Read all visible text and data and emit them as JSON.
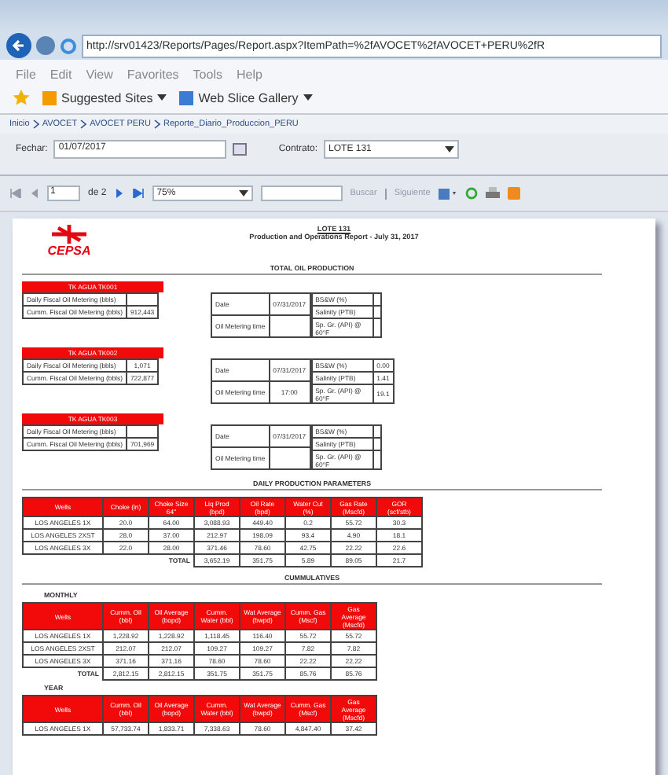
{
  "browser": {
    "url": "http://srv01423/Reports/Pages/Report.aspx?ItemPath=%2fAVOCET%2fAVOCET+PERU%2fR",
    "menu": [
      "File",
      "Edit",
      "View",
      "Favorites",
      "Tools",
      "Help"
    ],
    "favorites": [
      "Suggested Sites",
      "Web Slice Gallery"
    ]
  },
  "breadcrumb": [
    "Inicio",
    "AVOCET",
    "AVOCET PERU",
    "Reporte_Diario_Produccion_PERU"
  ],
  "params": [
    {
      "label": "Fechar:",
      "value": "01/07/2017",
      "kind": "date"
    },
    {
      "label": "Contrato:",
      "value": "LOTE 131",
      "kind": "select"
    }
  ],
  "toolbar": {
    "page": "1",
    "of": "de 2",
    "zoom": "75%",
    "find": "Buscar",
    "next": "Siguiente"
  },
  "report": {
    "logo": "CEPSA",
    "title": "LOTE 131",
    "subtitle": "Production and Operations Report - July 31, 2017",
    "section": "TOTAL OIL PRODUCTION",
    "tanks": [
      {
        "name": "TK AGUA TK001",
        "rows": [
          [
            "Daily Fiscal Oil Metering (bbls)"
          ],
          [
            "Cumm. Fiscal Oil Metering (bbls)",
            "912,443"
          ]
        ],
        "info": [
          [
            "Date",
            "07/31/2017"
          ],
          [
            "Oil Metering time"
          ]
        ],
        "quality": [
          [
            "BS&W (%)"
          ],
          [
            "Salinity (PTB)"
          ],
          [
            "Sp. Gr. (API) @ 60°F"
          ]
        ]
      },
      {
        "name": "TK AGUA TK002",
        "rows": [
          [
            "Daily Fiscal Oil Metering (bbls)",
            "1,071"
          ],
          [
            "Cumm. Fiscal Oil Metering (bbls)",
            "722,877"
          ]
        ],
        "info": [
          [
            "Date",
            "07/31/2017"
          ],
          [
            "Oil Metering time",
            "17:00"
          ]
        ],
        "quality": [
          [
            "BS&W (%)",
            "0.00"
          ],
          [
            "Salinity (PTB)",
            "1.41"
          ],
          [
            "Sp. Gr. (API) @ 60°F",
            "19.1"
          ]
        ]
      },
      {
        "name": "TK AGUA TK003",
        "rows": [
          [
            "Daily Fiscal Oil Metering (bbls)"
          ],
          [
            "Cumm. Fiscal Oil Metering (bbls)",
            "701,969"
          ]
        ],
        "info": [
          [
            "Date",
            "07/31/2017"
          ],
          [
            "Oil Metering time"
          ]
        ],
        "quality": [
          [
            "BS&W (%)"
          ],
          [
            "Salinity (PTB)"
          ],
          [
            "Sp. Gr. (API) @ 60°F"
          ]
        ]
      }
    ],
    "daily": {
      "title": "DAILY PRODUCTION PARAMETERS",
      "columns": [
        "Wells",
        "Choke (in)",
        "Choke Size 64\"",
        "Liq Prod (bpd)",
        "Oil Rate (bpd)",
        "Water Cut (%)",
        "Gas Rate (Mscfd)",
        "GOR (scf/stb)"
      ],
      "rows": [
        [
          "LOS ANGELES 1X",
          "20.0",
          "64.00",
          "3,088.93",
          "449.40",
          "0.2",
          "55.72",
          "30.3"
        ],
        [
          "LOS ANGELES 2XST",
          "28.0",
          "37.00",
          "212.97",
          "198.09",
          "93.4",
          "4.90",
          "18.1"
        ],
        [
          "LOS ANGELES 3X",
          "22.0",
          "28.00",
          "371.46",
          "78.60",
          "42.75",
          "22.22",
          "22.6"
        ]
      ],
      "total": [
        "TOTAL",
        "3,652.19",
        "351.75",
        "5.89",
        "89.05",
        "21.7"
      ]
    },
    "cumulatives": {
      "title": "CUMMULATIVES",
      "groups": [
        {
          "name": "MONTHLY",
          "columns": [
            "Wells",
            "Cumm. Oil (bbl)",
            "Oil Average (bopd)",
            "Cumm. Water (bbl)",
            "Wat Average (bwpd)",
            "Cumm. Gas (Mscf)",
            "Gas Average (Mscfd)"
          ],
          "rows": [
            [
              "LOS ANGELES 1X",
              "1,228.92",
              "1,228.92",
              "1,118.45",
              "116.40",
              "55.72",
              "55.72"
            ],
            [
              "LOS ANGELES 2XST",
              "212.07",
              "212.07",
              "109.27",
              "109.27",
              "7.82",
              "7.82"
            ],
            [
              "LOS ANGELES 3X",
              "371.16",
              "371.16",
              "78.60",
              "78.60",
              "22.22",
              "22.22"
            ]
          ],
          "total": [
            "TOTAL",
            "2,812.15",
            "2,812.15",
            "351.75",
            "351.75",
            "85.76",
            "85.76"
          ]
        },
        {
          "name": "YEAR",
          "columns": [
            "Wells",
            "Cumm. Oil (bbl)",
            "Oil Average (bopd)",
            "Cumm. Water (bbl)",
            "Wat Average (bwpd)",
            "Cumm. Gas (Mscf)",
            "Gas Average (Mscfd)"
          ],
          "rows": [
            [
              "LOS ANGELES 1X",
              "57,733.74",
              "1,833.71",
              "7,338.63",
              "78.60",
              "4,847.40",
              "37.42"
            ]
          ]
        }
      ]
    }
  }
}
